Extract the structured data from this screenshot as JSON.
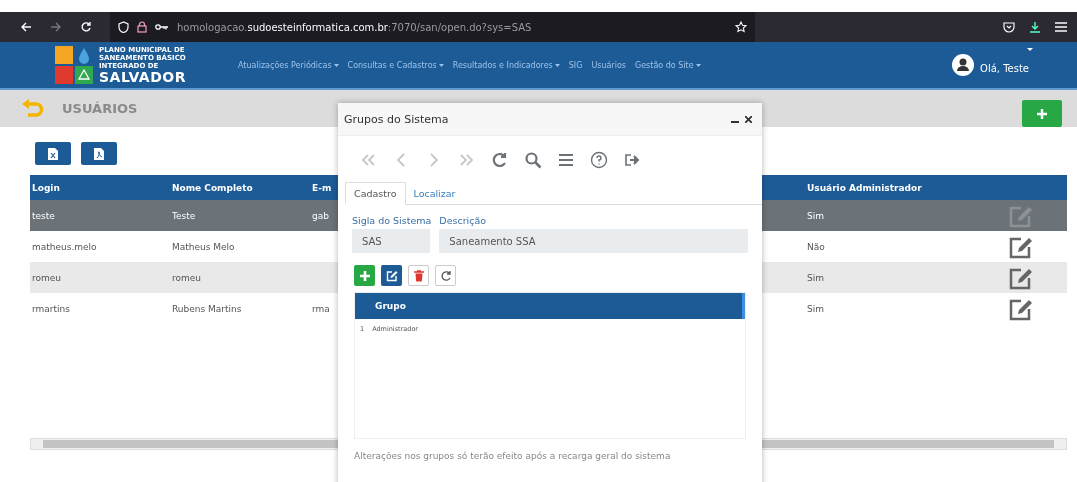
{
  "browser": {
    "url": "homologacao.**sudoesteinformatica.com.br**:7070/san/open.do?sys=SAS"
  },
  "header": {
    "logo_lines": [
      "PLANO MUNICIPAL DE",
      "SANEAMENTO BÁSICO",
      "INTEGRADO DE"
    ],
    "logo_title": "SALVADOR",
    "nav": [
      {
        "label": "Atualizações Periódicas",
        "dropdown": true
      },
      {
        "label": "Consultas e Cadastros",
        "dropdown": true
      },
      {
        "label": "Resultados e Indicadores",
        "dropdown": true
      },
      {
        "label": "SIG",
        "dropdown": false
      },
      {
        "label": "Usuários",
        "dropdown": false
      },
      {
        "label": "Gestão do Site",
        "dropdown": true
      }
    ],
    "user": "Olá, Teste"
  },
  "page": {
    "title": "USUÁRIOS"
  },
  "table": {
    "columns": [
      "Login",
      "Nome Completo",
      "E-m",
      "Usuário Administrador"
    ],
    "rows": [
      {
        "cells": [
          "teste",
          "Teste",
          "gab",
          "Sim"
        ],
        "selected": true
      },
      {
        "cells": [
          "matheus.melo",
          "Matheus Melo",
          "",
          "Não"
        ],
        "selected": false
      },
      {
        "cells": [
          "romeu",
          "romeu",
          "",
          "Sim"
        ],
        "selected": false
      },
      {
        "cells": [
          "rmartins",
          "Rubens Martins",
          "rma",
          "Sim"
        ],
        "selected": false
      }
    ]
  },
  "dialog": {
    "title": "Grupos do Sistema",
    "toolbar": [
      {
        "kind": "first",
        "disabled": true
      },
      {
        "kind": "prev",
        "disabled": true
      },
      {
        "kind": "next",
        "disabled": true
      },
      {
        "kind": "last",
        "disabled": true
      },
      {
        "kind": "reload",
        "disabled": false
      },
      {
        "kind": "search",
        "disabled": false
      },
      {
        "kind": "list",
        "disabled": false
      },
      {
        "kind": "help",
        "disabled": false
      },
      {
        "kind": "exit",
        "disabled": false
      }
    ],
    "tabs": [
      {
        "label": "Cadastro",
        "selected": true
      },
      {
        "label": "Localizar",
        "selected": false
      }
    ],
    "fields": [
      {
        "label": "Sigla do Sistema",
        "value": "SAS"
      },
      {
        "label": "Descrição",
        "value": "Saneamento SSA"
      }
    ],
    "actions": [
      {
        "kind": "add"
      },
      {
        "kind": "edit"
      },
      {
        "kind": "delete"
      },
      {
        "kind": "reload"
      }
    ],
    "grid": {
      "column": "Grupo",
      "rows": [
        {
          "number": "1",
          "name": "Administrador"
        }
      ]
    },
    "note": "Alterações nos grupos só terão efeito após a recarga geral do sistema"
  }
}
